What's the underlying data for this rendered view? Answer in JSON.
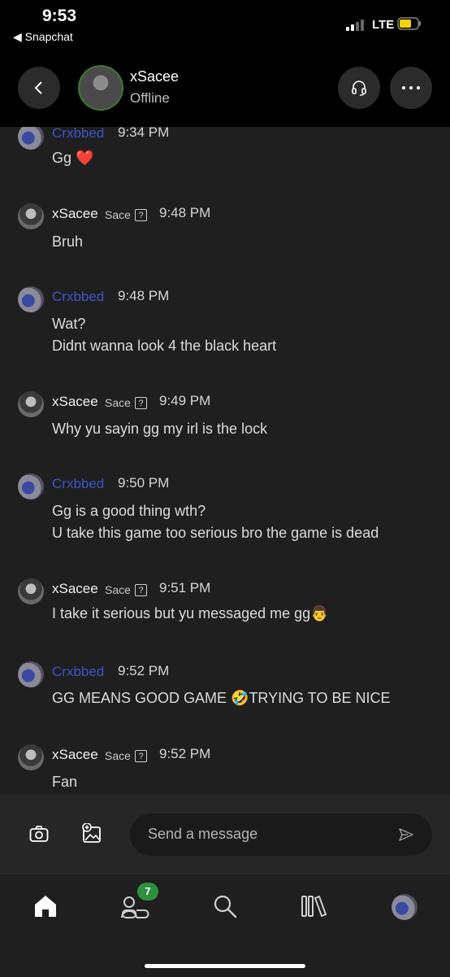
{
  "status_bar": {
    "time": "9:53",
    "back_app": "◀ Snapchat",
    "network": "LTE"
  },
  "header": {
    "name": "xSacee",
    "status": "Offline"
  },
  "messages": [
    {
      "sender": "Crxbbed",
      "tag": "",
      "time": "9:34 PM",
      "lines": [
        "Gg ❤️"
      ]
    },
    {
      "sender": "xSacee",
      "tag": "Sace",
      "time": "9:48 PM",
      "lines": [
        "Bruh"
      ]
    },
    {
      "sender": "Crxbbed",
      "tag": "",
      "time": "9:48 PM",
      "lines": [
        "Wat?",
        "Didnt wanna look 4 the black heart"
      ]
    },
    {
      "sender": "xSacee",
      "tag": "Sace",
      "time": "9:49 PM",
      "lines": [
        "Why yu sayin gg my irl is the lock"
      ]
    },
    {
      "sender": "Crxbbed",
      "tag": "",
      "time": "9:50 PM",
      "lines": [
        "Gg is a good thing wth?",
        "U take this game too serious bro the game is dead"
      ]
    },
    {
      "sender": "xSacee",
      "tag": "Sace",
      "time": "9:51 PM",
      "lines": [
        "I take it serious but yu messaged me gg👨"
      ]
    },
    {
      "sender": "Crxbbed",
      "tag": "",
      "time": "9:52 PM",
      "lines": [
        "GG MEANS GOOD GAME 🤣TRYING TO BE NICE"
      ]
    },
    {
      "sender": "xSacee",
      "tag": "Sace",
      "time": "9:52 PM",
      "lines": [
        "Fan"
      ]
    }
  ],
  "composer": {
    "placeholder": "Send a message"
  },
  "tabbar": {
    "friends_badge": "7"
  },
  "icons": {
    "back": "chevron-left-icon",
    "headset": "headset-icon",
    "more": "more-horizontal-icon",
    "camera": "camera-icon",
    "image": "image-add-icon",
    "send": "send-icon",
    "home": "home-icon",
    "friends": "friends-icon",
    "search": "search-icon",
    "library": "library-icon"
  },
  "colors": {
    "background": "#1f1f1f",
    "header": "#000000",
    "crxbbed_name": "#3d55c8",
    "badge": "#2f8f3e"
  }
}
